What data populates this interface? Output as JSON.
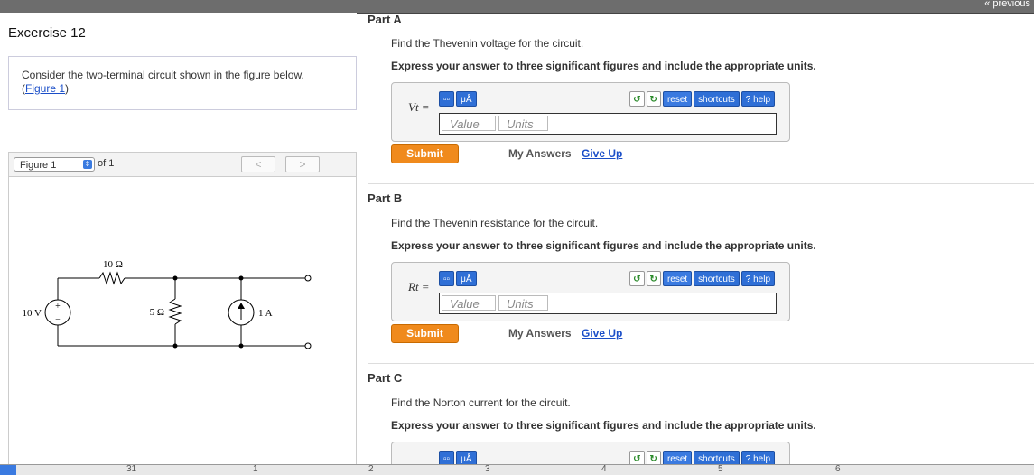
{
  "topbar": {
    "previous_label": "« previous"
  },
  "exercise": {
    "title": "Excercise 12",
    "prompt": "Consider the two-terminal circuit shown in the figure below.",
    "figure_link": "Figure 1"
  },
  "figure_nav": {
    "select_value": "Figure 1",
    "of_label": "of 1",
    "prev_label": "<",
    "next_label": ">"
  },
  "circuit": {
    "voltage_source": "10 V",
    "r_series": "10 Ω",
    "r_shunt": "5 Ω",
    "current_source": "1 A",
    "plus": "+",
    "minus": "−"
  },
  "toolbar": {
    "templates_label": "▫▫",
    "units_label": "μÅ",
    "undo_label": "↺",
    "redo_label": "↻",
    "reset_label": "reset",
    "shortcuts_label": "shortcuts",
    "help_label": "help"
  },
  "parts": [
    {
      "title": "Part A",
      "question": "Find the Thevenin voltage for the circuit.",
      "instruction": "Express your answer to three significant figures and include the appropriate units.",
      "variable": "Vt =",
      "value_placeholder": "Value",
      "units_placeholder": "Units",
      "submit_label": "Submit",
      "my_answers_label": "My Answers",
      "give_up_label": "Give Up"
    },
    {
      "title": "Part B",
      "question": "Find the Thevenin resistance for the circuit.",
      "instruction": "Express your answer to three significant figures and include the appropriate units.",
      "variable": "Rt =",
      "value_placeholder": "Value",
      "units_placeholder": "Units",
      "submit_label": "Submit",
      "my_answers_label": "My Answers",
      "give_up_label": "Give Up"
    },
    {
      "title": "Part C",
      "question": "Find the Norton current for the circuit.",
      "instruction": "Express your answer to three significant figures and include the appropriate units."
    }
  ],
  "bottombar": {
    "marks": [
      "31",
      "1",
      "2",
      "3",
      "4",
      "5",
      "6"
    ]
  },
  "colors": {
    "submit": "#f08a1c",
    "link": "#1a4ec8",
    "toolbar_blue": "#2f6fd6"
  }
}
